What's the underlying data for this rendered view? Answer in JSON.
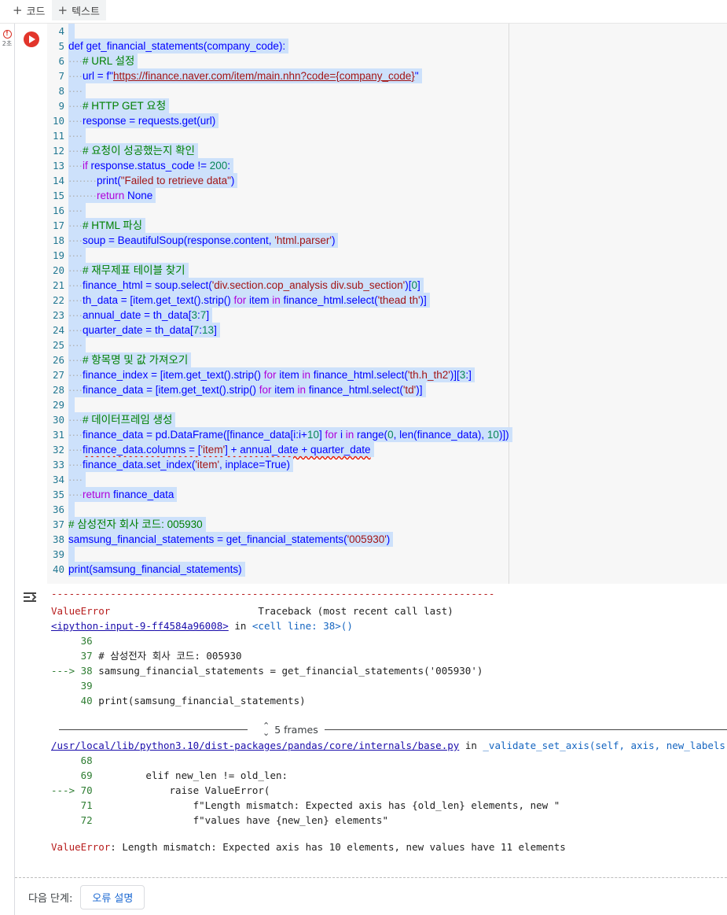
{
  "toolbar": {
    "add_code": "코드",
    "add_text": "텍스트"
  },
  "cell": {
    "exec_time": "2초"
  },
  "code_lines": [
    {
      "n": "4",
      "html": ""
    },
    {
      "n": "5",
      "html": "def get_financial_statements(company_code):"
    },
    {
      "n": "6",
      "html": "····<span class=\"c\"># URL 설정</span>"
    },
    {
      "n": "7",
      "html": "····url = f\"<span class=\"s u\">https://finance.naver.com/item/main.nhn?code={company_code}</span>\""
    },
    {
      "n": "8",
      "html": "····"
    },
    {
      "n": "9",
      "html": "····<span class=\"c\"># HTTP GET 요청</span>"
    },
    {
      "n": "10",
      "html": "····response = requests.get(url)"
    },
    {
      "n": "11",
      "html": "····"
    },
    {
      "n": "12",
      "html": "····<span class=\"c\"># 요청이 성공했는지 확인</span>"
    },
    {
      "n": "13",
      "html": "····<span class=\"k\">if</span> response.status_code != <span class=\"n\">200</span>:"
    },
    {
      "n": "14",
      "html": "········print(<span class=\"s\">\"Failed to retrieve data\"</span>)"
    },
    {
      "n": "15",
      "html": "········<span class=\"k\">return</span> None"
    },
    {
      "n": "16",
      "html": "····"
    },
    {
      "n": "17",
      "html": "····<span class=\"c\"># HTML 파싱</span>"
    },
    {
      "n": "18",
      "html": "····soup = BeautifulSoup(response.content, <span class=\"s\">'html.parser'</span>)"
    },
    {
      "n": "19",
      "html": "····"
    },
    {
      "n": "20",
      "html": "····<span class=\"c\"># 재무제표 테이블 찾기</span>"
    },
    {
      "n": "21",
      "html": "····finance_html = soup.select(<span class=\"s\">'div.section.cop_analysis div.sub_section'</span>)[<span class=\"n\">0</span>]"
    },
    {
      "n": "22",
      "html": "····th_data = [item.get_text().strip() <span class=\"k\">for</span> item <span class=\"k\">in</span> finance_html.select(<span class=\"s\">'thead th'</span>)]"
    },
    {
      "n": "23",
      "html": "····annual_date = th_data[<span class=\"n\">3</span>:<span class=\"n\">7</span>]"
    },
    {
      "n": "24",
      "html": "····quarter_date = th_data[<span class=\"n\">7</span>:<span class=\"n\">13</span>]"
    },
    {
      "n": "25",
      "html": "····"
    },
    {
      "n": "26",
      "html": "····<span class=\"c\"># 항목명 및 값 가져오기</span>"
    },
    {
      "n": "27",
      "html": "····finance_index = [item.get_text().strip() <span class=\"k\">for</span> item <span class=\"k\">in</span> finance_html.select(<span class=\"s\">'th.h_th2'</span>)][<span class=\"n\">3</span>:]"
    },
    {
      "n": "28",
      "html": "····finance_data = [item.get_text().strip() <span class=\"k\">for</span> item <span class=\"k\">in</span> finance_html.select(<span class=\"s\">'td'</span>)]"
    },
    {
      "n": "29",
      "html": ""
    },
    {
      "n": "30",
      "html": "····<span class=\"c\"># 데이터프레임 생성</span>"
    },
    {
      "n": "31",
      "html": "····finance_data = pd.DataFrame([finance_data[i:i+<span class=\"n\">10</span>] <span class=\"k\">for</span> i <span class=\"k\">in</span> range(<span class=\"n\">0</span>, len(finance_data), <span class=\"n\">10</span>)])"
    },
    {
      "n": "32",
      "html": "····<span class=\"squiggle\">finance_data.columns = [<span class=\"s\">'item'</span>] + annual_date + quarter_date</span>"
    },
    {
      "n": "33",
      "html": "····finance_data.set_index(<span class=\"s\">'item'</span>, inplace=True)"
    },
    {
      "n": "34",
      "html": "····"
    },
    {
      "n": "35",
      "html": "····<span class=\"k\">return</span> finance_data"
    },
    {
      "n": "36",
      "html": ""
    },
    {
      "n": "37",
      "html": "<span class=\"c\"># 삼성전자 회사 코드: 005930</span>"
    },
    {
      "n": "38",
      "html": "samsung_financial_statements = get_financial_statements(<span class=\"s\">'005930'</span>)"
    },
    {
      "n": "39",
      "html": ""
    },
    {
      "n": "40",
      "html": "print(samsung_financial_statements)"
    }
  ],
  "output": {
    "dashes": "---------------------------------------------------------------------------",
    "error_name": "ValueError",
    "traceback_label": "Traceback (most recent call last)",
    "input_link": "<ipython-input-9-ff4584a96008>",
    "in_word": "in",
    "cell_line": "<cell line: 38>()",
    "tb1": [
      {
        "arrow": "   ",
        "num": "36",
        "text": ""
      },
      {
        "arrow": "   ",
        "num": "37",
        "text": "# 삼성전자 회사 코드: 005930"
      },
      {
        "arrow": "--->",
        "num": "38",
        "text": "samsung_financial_statements = get_financial_statements('005930')"
      },
      {
        "arrow": "   ",
        "num": "39",
        "text": ""
      },
      {
        "arrow": "   ",
        "num": "40",
        "text": "print(samsung_financial_statements)"
      }
    ],
    "frames_label": "5 frames",
    "file_link": "/usr/local/lib/python3.10/dist-packages/pandas/core/internals/base.py",
    "func": "_validate_set_axis(self, axis, new_labels)",
    "tb2": [
      {
        "arrow": "   ",
        "num": "68",
        "text": ""
      },
      {
        "arrow": "   ",
        "num": "69",
        "text": "        elif new_len != old_len:"
      },
      {
        "arrow": "--->",
        "num": "70",
        "text": "            raise ValueError("
      },
      {
        "arrow": "   ",
        "num": "71",
        "text": "                f\"Length mismatch: Expected axis has {old_len} elements, new \""
      },
      {
        "arrow": "   ",
        "num": "72",
        "text": "                f\"values have {new_len} elements\""
      }
    ],
    "final_error_name": "ValueError",
    "final_error_msg": ": Length mismatch: Expected axis has 10 elements, new values have 11 elements"
  },
  "next_steps": {
    "label": "다음 단계:",
    "button": "오류 설명"
  },
  "colors": {
    "accent": "#1967d2",
    "run_button": "#e2352b",
    "selection": "#cde1fb",
    "error": "#b71c1c"
  },
  "icons": [
    "plus-icon",
    "error-icon",
    "run-icon",
    "output-toggle-icon",
    "chevron-updown-icon"
  ]
}
